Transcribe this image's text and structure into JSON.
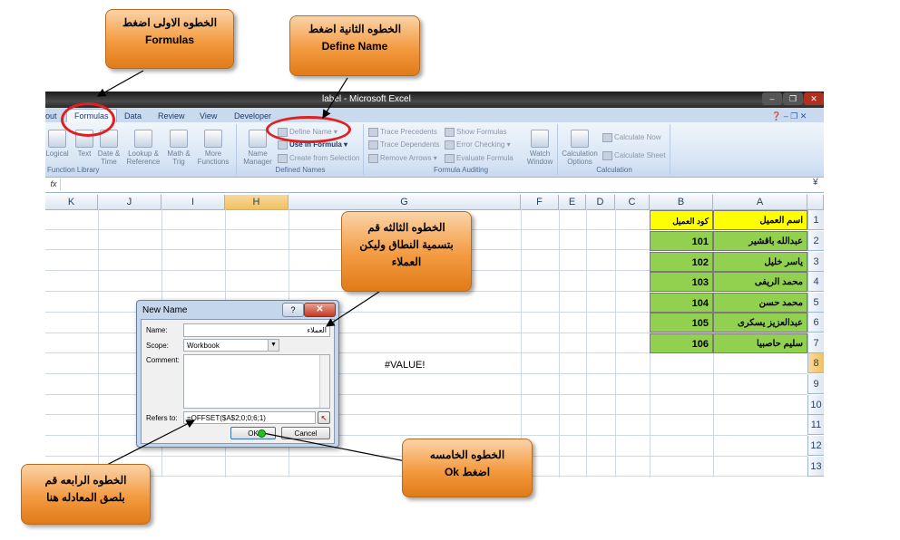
{
  "window": {
    "title": "label - Microsoft Excel",
    "minimize": "–",
    "restore": "❐",
    "close": "✕"
  },
  "ribbon_tabs": [
    "out",
    "Formulas",
    "Data",
    "Review",
    "View",
    "Developer"
  ],
  "ribbon": {
    "function_library": {
      "label": "Function Library",
      "buttons": [
        "Logical",
        "Text",
        "Date & Time",
        "Lookup & Reference",
        "Math & Trig",
        "More Functions"
      ]
    },
    "defined_names": {
      "label": "Defined Names",
      "name_manager": "Name Manager",
      "define_name": "Define Name",
      "use_in_formula": "Use in Formula",
      "create_from_selection": "Create from Selection"
    },
    "formula_auditing": {
      "label": "Formula Auditing",
      "trace_precedents": "Trace Precedents",
      "trace_dependents": "Trace Dependents",
      "remove_arrows": "Remove Arrows",
      "show_formulas": "Show Formulas",
      "error_checking": "Error Checking",
      "evaluate_formula": "Evaluate Formula",
      "watch_window": "Watch Window"
    },
    "calculation": {
      "label": "Calculation",
      "options": "Calculation Options",
      "calc_now": "Calculate Now",
      "calc_sheet": "Calculate Sheet"
    }
  },
  "formula_bar": {
    "fx": "fx",
    "content": ""
  },
  "columns": [
    "K",
    "J",
    "I",
    "H",
    "G",
    "F",
    "E",
    "D",
    "C",
    "B",
    "A"
  ],
  "rows": [
    "1",
    "2",
    "3",
    "4",
    "5",
    "6",
    "7",
    "8",
    "9",
    "10",
    "11",
    "12",
    "13"
  ],
  "sheet": {
    "header_a": "اسم العميل",
    "header_b": "كود العميل",
    "names": [
      "عبدالله باقشير",
      "ياسر خليل",
      "محمد الريفى",
      "محمد حسن",
      "عبدالعزيز يسكرى",
      "سليم حاصبيا"
    ],
    "codes": [
      "101",
      "102",
      "103",
      "104",
      "105",
      "106"
    ],
    "value_error": "#VALUE!"
  },
  "dialog": {
    "title": "New Name",
    "help": "?",
    "close": "✕",
    "name_label": "Name:",
    "name_value": "العملاء",
    "scope_label": "Scope:",
    "scope_value": "Workbook",
    "comment_label": "Comment:",
    "refers_label": "Refers to:",
    "refers_value": "=OFFSET($A$2;0;0;6;1)",
    "ok": "OK",
    "cancel": "Cancel"
  },
  "callouts": {
    "step1": [
      "الخطوه الاولى اضغط",
      "Formulas"
    ],
    "step2": [
      "الخطوه الثانية اضغط",
      "Define Name"
    ],
    "step3": [
      "الخطوه الثالثه قم",
      "بتسمية النطاق وليكن",
      "العملاء"
    ],
    "step4": [
      "الخطوه الرابعه قم",
      "بلصق المعادله هنا"
    ],
    "step5": [
      "الخطوه الخامسه",
      "اضغط Ok"
    ]
  },
  "colors": {
    "callout": "#f39a40",
    "highlight_ellipse": "#e02020",
    "header_fill": "#ffff00",
    "data_fill": "#92d050"
  }
}
